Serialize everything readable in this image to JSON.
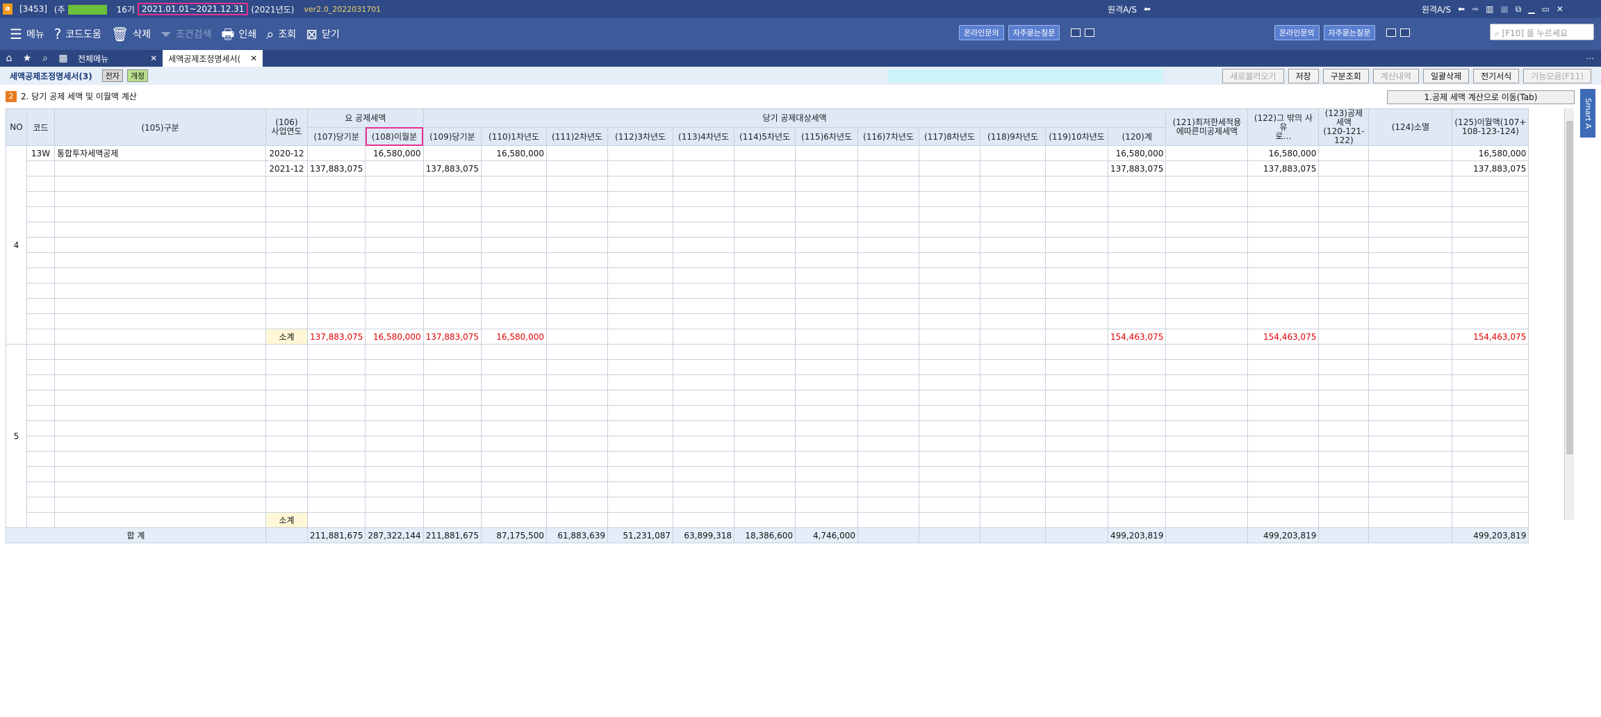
{
  "titlebar": {
    "company_code": "[3453]",
    "company_prefix": "(주",
    "term": "16기",
    "period": "2021.01.01~2021.12.31",
    "year": "(2021년도)",
    "version": "ver2.0_2022031701",
    "remote_as_1": "원격A/S",
    "remote_as_2": "원격A/S"
  },
  "toolbar": {
    "menu": "메뉴",
    "code_help": "코드도움",
    "delete": "삭제",
    "condition_search": "조건검색",
    "print": "인쇄",
    "query": "조회",
    "close": "닫기",
    "online_inquiry": "온라인문의",
    "faq": "자주묻는질문",
    "search_placeholder": "[F10] 을 누르세요"
  },
  "tabs": {
    "all_menu": "전체메뉴",
    "active_tab": "세액공제조정명세서("
  },
  "subbar": {
    "title": "세액공제조정명세서(3)",
    "badge_electronic": "전자",
    "badge_revised": "개정",
    "buttons": [
      "새로불러오기",
      "저장",
      "구분조회",
      "계산내역",
      "일괄삭제",
      "전기서식",
      "기능모음(F11)"
    ]
  },
  "section": {
    "num": "2",
    "title": "2. 당기 공제 세액 및 이월액 계산",
    "move_button": "1.공제 세액 계산으로 이동(Tab)",
    "smart_a": "Smart A"
  },
  "table": {
    "headers_top": {
      "no": "NO",
      "code": "코드",
      "category": "(105)구분",
      "biz_year": "(106)\n사업연도",
      "req_credit": "요 공제세액",
      "current_credit_target": "당기 공제대상세액",
      "col121": "(121)최저한세적용\n에따른미공제세액",
      "col122": "(122)그 밖의 사유\n로…",
      "col123": "(123)공제세액\n(120-121-122)",
      "col124": "(124)소멸",
      "col125": "(125)이월액(107+\n108-123-124)"
    },
    "headers_sub": [
      "(107)당기분",
      "(108)이월분",
      "(109)당기분",
      "(110)1차년도",
      "(111)2차년도",
      "(112)3차년도",
      "(113)4차년도",
      "(114)5차년도",
      "(115)6차년도",
      "(116)7차년도",
      "(117)8차년도",
      "(118)9차년도",
      "(119)10차년도",
      "(120)계"
    ],
    "group4": {
      "no": "4",
      "rows": [
        {
          "code": "13W",
          "name": "통합투자세액공제",
          "year": "2020-12",
          "c107": "",
          "c108": "16,580,000",
          "c109": "",
          "c110": "16,580,000",
          "c120": "16,580,000",
          "c122": "16,580,000",
          "c125": "16,580,000"
        },
        {
          "code": "",
          "name": "",
          "year": "2021-12",
          "c107": "137,883,075",
          "c108": "",
          "c109": "137,883,075",
          "c110": "",
          "c120": "137,883,075",
          "c122": "137,883,075",
          "c125": "137,883,075"
        }
      ],
      "subtotal_label": "소계",
      "subtotal": {
        "c107": "137,883,075",
        "c108": "16,580,000",
        "c109": "137,883,075",
        "c110": "16,580,000",
        "c120": "154,463,075",
        "c122": "154,463,075",
        "c125": "154,463,075"
      }
    },
    "group5": {
      "no": "5",
      "subtotal_label": "소계"
    },
    "total": {
      "label": "합        계",
      "c107": "211,881,675",
      "c108": "287,322,144",
      "c109": "211,881,675",
      "c110": "87,175,500",
      "c111": "61,883,639",
      "c112": "51,231,087",
      "c113": "63,899,318",
      "c114": "18,386,600",
      "c115": "4,746,000",
      "c120": "499,203,819",
      "c122": "499,203,819",
      "c125": "499,203,819"
    }
  }
}
